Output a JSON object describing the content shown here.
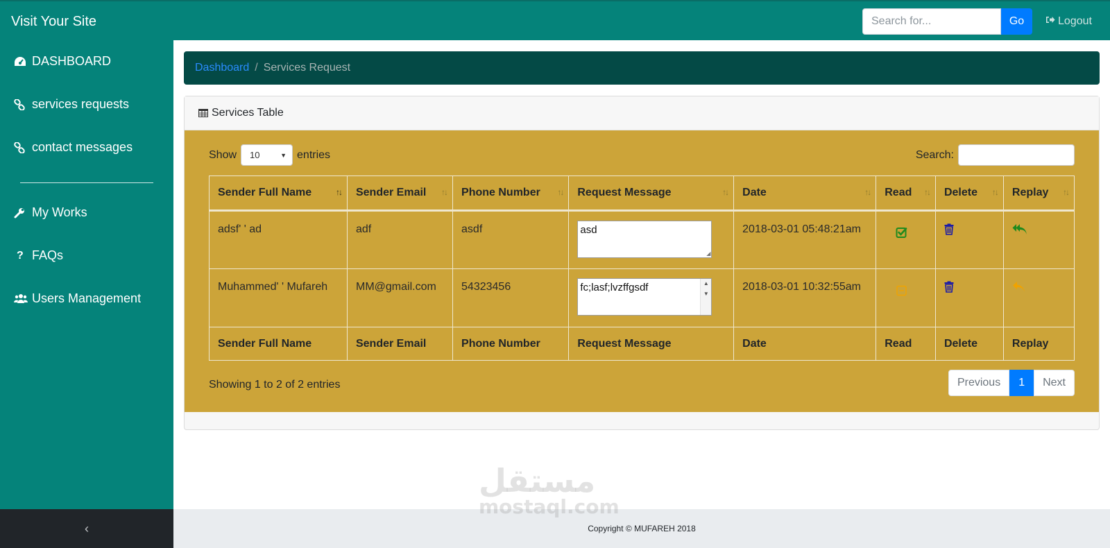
{
  "app": {
    "brand": "Visit Your Site"
  },
  "topbar": {
    "search_placeholder": "Search for...",
    "go_label": "Go",
    "logout_label": "Logout"
  },
  "sidebar": {
    "items": [
      {
        "label": "DASHBOARD",
        "icon": "tachometer-icon"
      },
      {
        "label": "services requests",
        "icon": "link-icon"
      },
      {
        "label": "contact messages",
        "icon": "link-icon"
      },
      {
        "label": "My Works",
        "icon": "wrench-icon"
      },
      {
        "label": "FAQs",
        "icon": "question-icon"
      },
      {
        "label": "Users Management",
        "icon": "users-icon"
      }
    ],
    "toggle_glyph": "‹"
  },
  "breadcrumb": {
    "root": "Dashboard",
    "separator": "/",
    "current": "Services Request"
  },
  "card": {
    "title": "Services Table"
  },
  "table_controls": {
    "show_label": "Show",
    "entries_label": "entries",
    "page_length": "10",
    "search_label": "Search:",
    "search_value": ""
  },
  "table": {
    "columns": [
      "Sender Full Name",
      "Sender Email",
      "Phone Number",
      "Request Message",
      "Date",
      "Read",
      "Delete",
      "Replay"
    ],
    "rows": [
      {
        "name": "adsf' ' ad",
        "email": "adf",
        "phone": "asdf",
        "message": "asd",
        "date": "2018-03-01 05:48:21am",
        "read": true
      },
      {
        "name": "Muhammed' ' Mufareh",
        "email": "MM@gmail.com",
        "phone": "54323456",
        "message": "fc;lasf;lvzffgsdf",
        "date": "2018-03-01 10:32:55am",
        "read": false
      }
    ]
  },
  "table_footer": {
    "info": "Showing 1 to 2 of 2 entries",
    "previous": "Previous",
    "page": "1",
    "next": "Next"
  },
  "footer": {
    "copyright": "Copyright © MUFAREH 2018"
  },
  "watermark": {
    "arabic": "مستقل",
    "latin": "mostaql.com"
  },
  "colors": {
    "primary": "#05837a",
    "breadcrumb_bg": "#044a46",
    "table_bg": "#cca439",
    "link": "#2a8cff",
    "button": "#007bff",
    "read_check": "#1e8a1e",
    "unread": "#f0a300",
    "delete": "#1a1aa8",
    "reply_read": "#1e8a1e",
    "reply_unread": "#f0a300"
  }
}
